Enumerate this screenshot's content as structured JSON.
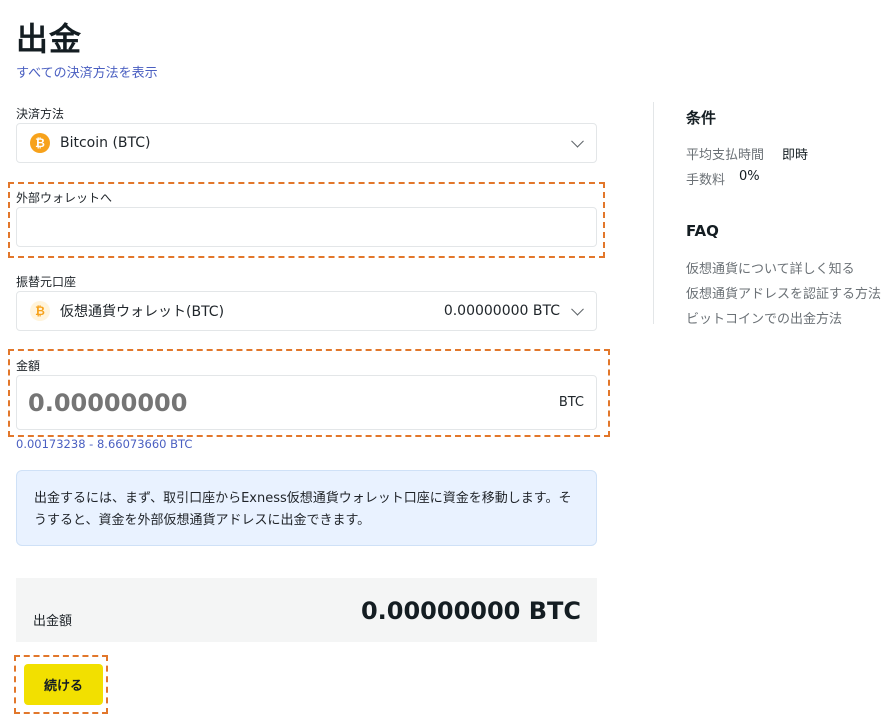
{
  "page": {
    "title": "出金",
    "all_methods_link": "すべての決済方法を表示"
  },
  "payment_method": {
    "label": "決済方法",
    "value": "Bitcoin (BTC)",
    "icon": "bitcoin-icon"
  },
  "external_wallet": {
    "label": "外部ウォレットへ",
    "value": "",
    "placeholder": ""
  },
  "source_account": {
    "label": "振替元口座",
    "value": "仮想通貨ウォレット(BTC)",
    "balance": "0.00000000 BTC",
    "icon": "bitcoin-icon"
  },
  "amount": {
    "label": "金額",
    "placeholder": "0.00000000",
    "currency": "BTC",
    "range": "0.00173238 - 8.66073660 BTC"
  },
  "info_box": {
    "text": "出金するには、まず、取引口座からExness仮想通貨ウォレット口座に資金を移動します。そうすると、資金を外部仮想通貨アドレスに出金できます。"
  },
  "summary": {
    "label": "出金額",
    "value": "0.00000000 BTC"
  },
  "continue_button": "続ける",
  "sidebar": {
    "conditions_title": "条件",
    "conditions": [
      {
        "key": "平均支払時間",
        "value": "即時"
      },
      {
        "key": "手数料",
        "value": "0%"
      }
    ],
    "faq_title": "FAQ",
    "faq_links": [
      "仮想通貨について詳しく知る",
      "仮想通貨アドレスを認証する方法",
      "ビットコインでの出金方法"
    ]
  },
  "colors": {
    "accent_link": "#4a5fc1",
    "highlight_dash": "#e2772b",
    "button_bg": "#f2e000",
    "info_bg": "#e9f2ff",
    "btc_orange": "#f7a21b"
  }
}
